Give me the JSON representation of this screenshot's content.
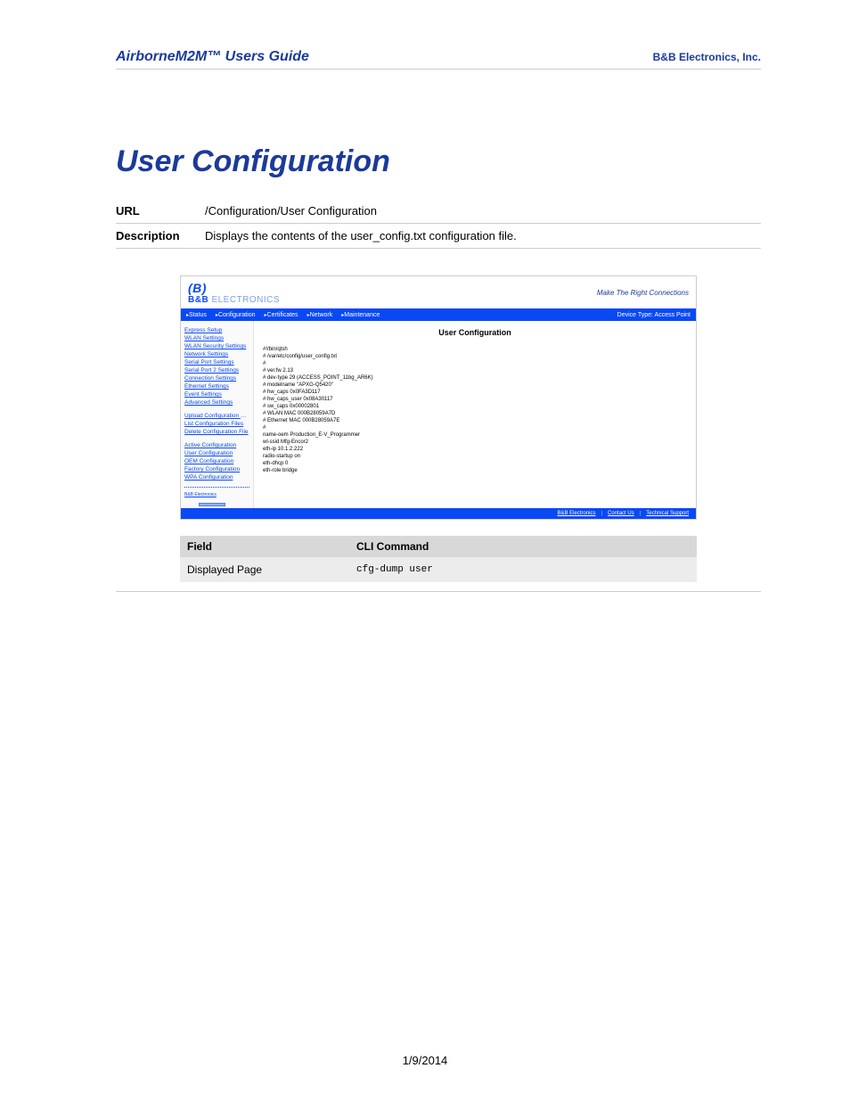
{
  "header": {
    "left": "AirborneM2M™ Users Guide",
    "right": "B&B Electronics, Inc."
  },
  "title": "User Configuration",
  "info": {
    "url_label": "URL",
    "url_value": "/Configuration/User Configuration",
    "desc_label": "Description",
    "desc_value": "Displays the contents of the user_config.txt configuration file."
  },
  "screenshot": {
    "brand_name": "B&B",
    "brand_suffix": " ELECTRONICS",
    "brand_icon": "(B)",
    "tagline": "Make The Right Connections",
    "nav_items": [
      "Status",
      "Configuration",
      "Certificates",
      "Network",
      "Maintenance"
    ],
    "nav_right": "Device Type: Access Point",
    "sidebar": {
      "group1": [
        "Express Setup",
        "WLAN Settings",
        "WLAN Security Settings",
        "Network Settings",
        "Serial Port Settings",
        "Serial Port 2 Settings",
        "Connection Settings",
        "Ethernet Settings",
        "Event Settings",
        "Advanced Settings"
      ],
      "group2": [
        "Upload Configuration File",
        "List Configuration Files",
        "Delete Configuration File"
      ],
      "group3": [
        "Active Configuration",
        "User Configuration",
        "OEM Configuration",
        "Factory Configuration",
        "WPA Configuration"
      ],
      "footlink": "B&B Electronics"
    },
    "main_title": "User Configuration",
    "config_text": "#!/bin/qtsh\n# /var/etc/config/user_config.txt\n#\n# ver.fw 2.13\n# dev-type 29 (ACCESS_POINT_11bg_AR6K)\n# modelname \"APXG-Q5420\"\n# hw_caps 0x0FA3D117\n# hw_caps_user 0x08A30117\n# sw_caps 0x00002801\n# WLAN MAC 000B28059A7D\n# Ethernet MAC 000B28059A7E\n#\nname-oem Production_E-V_Programmer\nwl-ssid Mfg-Encor2\neth-ip 10.1.2.222\nradio-startup on\neth-dhcp 0\neth-role bridge",
    "footer_links": [
      "B&B Electronics",
      "Contact Us",
      "Technical Support"
    ]
  },
  "cli_table": {
    "headers": [
      "Field",
      "CLI Command"
    ],
    "row": [
      "Displayed Page",
      "cfg-dump user"
    ]
  },
  "date": "1/9/2014"
}
